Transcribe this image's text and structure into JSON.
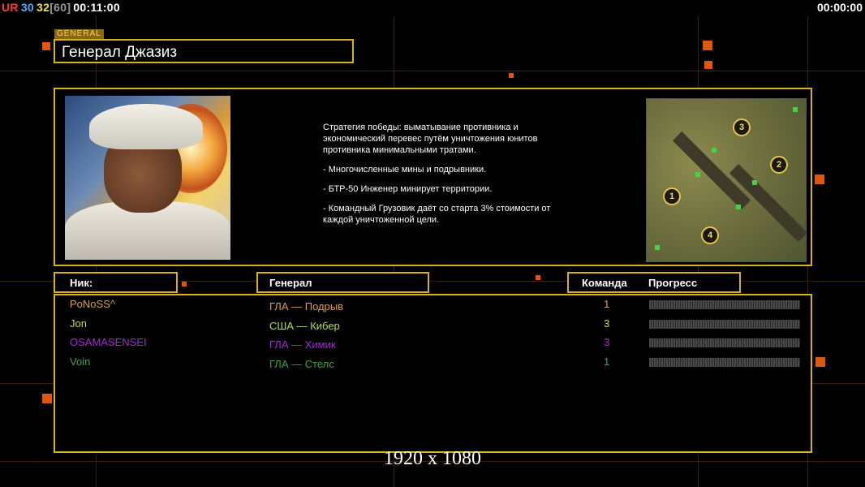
{
  "hud": {
    "counter_ur": "UR",
    "counter_a": "30",
    "counter_b": "32",
    "counter_c": "[60]",
    "clock_left": "00:11:00",
    "clock_right": "00:00:00"
  },
  "general_tag": "GENERAL",
  "title": "Генерал Джазиз",
  "description": {
    "strategy": "Стратегия победы: выматывание противника и экономический перевес путём уничтожения юнитов противника минимальными тратами.",
    "point1": "- Многочисленные мины и подрывники.",
    "point2": "- БТР-50 Инженер минирует территории.",
    "point3": "- Командный Грузовик даёт со старта 3% стоимости от каждой уничтоженной цели."
  },
  "minimap": {
    "spots": [
      "3",
      "2",
      "1",
      "4"
    ]
  },
  "headers": {
    "nick": "Ник:",
    "general": "Генерал",
    "team": "Команда",
    "progress": "Прогресс"
  },
  "players": [
    {
      "nick": "PoNoSS^",
      "general": "ГЛА — Подрыв",
      "team": "1",
      "color": "#e0a040"
    },
    {
      "nick": "Jon",
      "general": "США — Кибер",
      "team": "3",
      "color": "#b8e23c"
    },
    {
      "nick": "OSAMASENSEI",
      "general": "ГЛА — Химик",
      "team": "3",
      "color": "#a32ad6"
    },
    {
      "nick": "Voin",
      "general": "ГЛА — Стелс",
      "team": "1",
      "color": "#3aa83a"
    }
  ],
  "resolution": "1920 x 1080",
  "colors": {
    "frame": "#d8b21e",
    "accent_orange": "#e0560c",
    "ur": "#ff3b3b",
    "count_a": "#4fb0ff",
    "count_b": "#f0e04a",
    "count_c": "#9a9a9a"
  }
}
